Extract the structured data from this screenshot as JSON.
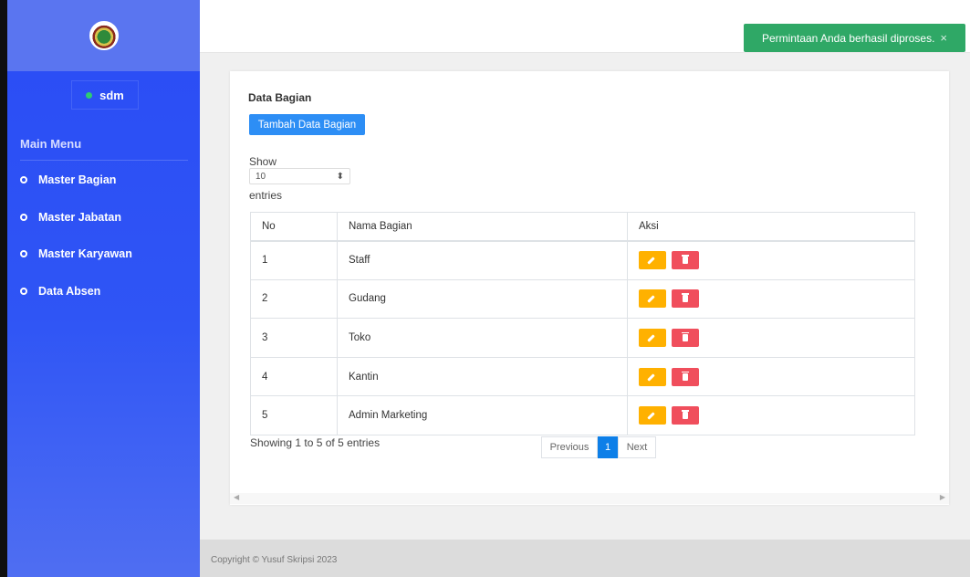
{
  "sidebar": {
    "user": {
      "name": "sdm",
      "status_color": "#2ecc71"
    },
    "menu_title": "Main Menu",
    "items": [
      {
        "label": "Master Bagian"
      },
      {
        "label": "Master Jabatan"
      },
      {
        "label": "Master Karyawan"
      },
      {
        "label": "Data Absen"
      }
    ]
  },
  "toast": {
    "message": "Permintaan Anda berhasil diproses.",
    "close": "×"
  },
  "main": {
    "title": "Data Bagian",
    "add_button": "Tambah Data Bagian",
    "show_label": "Show",
    "page_size": "10",
    "entries_label": "entries",
    "columns": [
      "No",
      "Nama Bagian",
      "Aksi"
    ],
    "rows": [
      {
        "no": "1",
        "name": "Staff"
      },
      {
        "no": "2",
        "name": "Gudang"
      },
      {
        "no": "3",
        "name": "Toko"
      },
      {
        "no": "4",
        "name": "Kantin"
      },
      {
        "no": "5",
        "name": "Admin Marketing"
      }
    ],
    "info": "Showing 1 to 5 of 5 entries",
    "pagination": {
      "previous": "Previous",
      "current": "1",
      "next": "Next"
    }
  },
  "footer": {
    "text": "Copyright © Yusuf Skripsi 2023"
  },
  "colors": {
    "sidebar": "#2f55f5",
    "primary": "#2d8ef5",
    "edit": "#ffb100",
    "delete": "#f04e5c",
    "toast": "#2fa866"
  }
}
